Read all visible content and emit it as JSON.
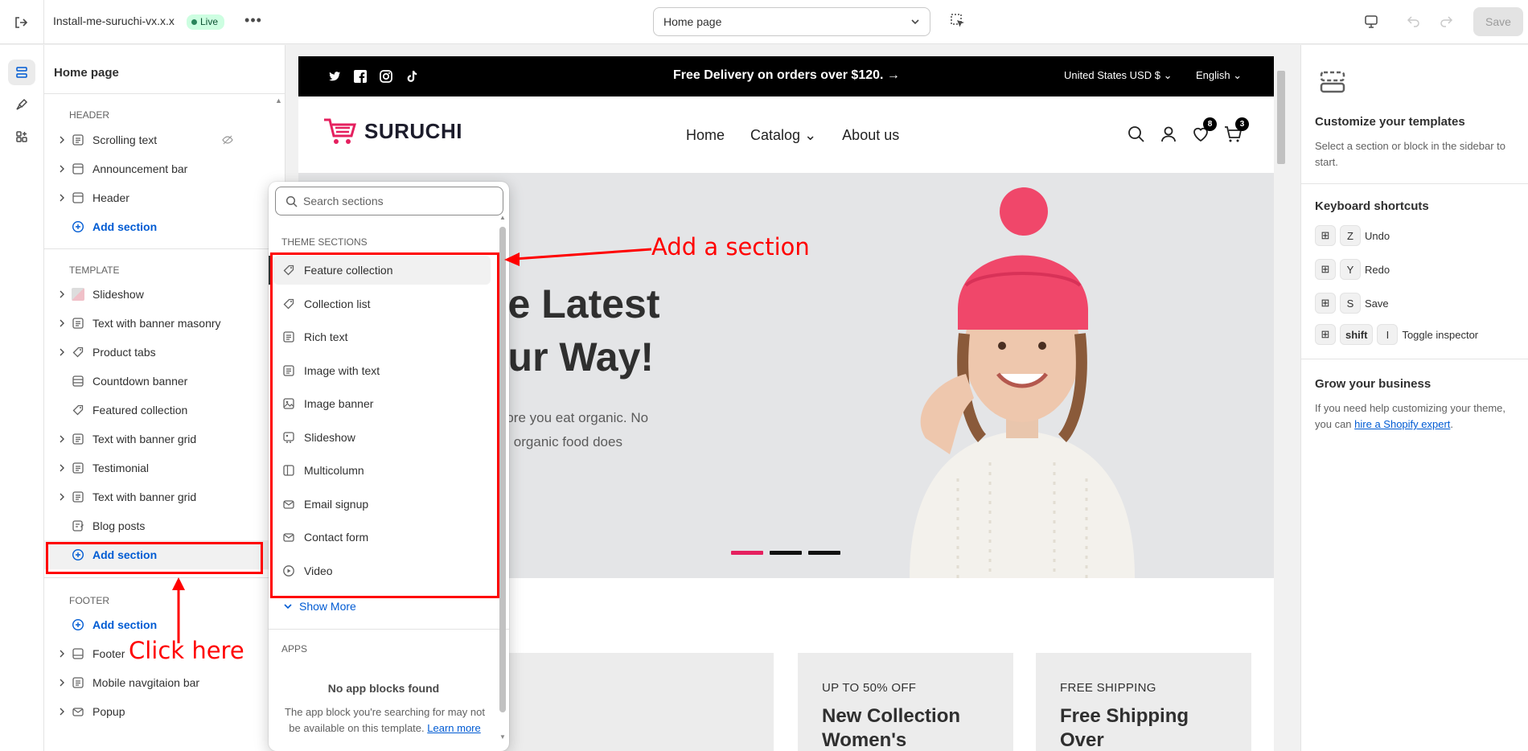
{
  "topbar": {
    "theme_name": "Install-me-suruchi-vx.x.x",
    "status_badge": "Live",
    "more_label": "•••",
    "page_select": "Home page",
    "save_label": "Save"
  },
  "sidebar": {
    "title": "Home page",
    "groups": {
      "header": "HEADER",
      "template": "TEMPLATE",
      "footer": "FOOTER"
    },
    "header_items": [
      "Scrolling text",
      "Announcement bar",
      "Header"
    ],
    "template_items": [
      "Slideshow",
      "Text with banner masonry",
      "Product tabs",
      "Countdown banner",
      "Featured collection",
      "Text with banner grid",
      "Testimonial",
      "Text with banner grid",
      "Blog posts"
    ],
    "footer_items": [
      "Footer",
      "Mobile navgitaion bar",
      "Popup"
    ],
    "add_section": "Add section"
  },
  "preview": {
    "announcement": "Free Delivery on orders over $120.",
    "currency": "United States USD $",
    "language": "English",
    "logo": "SURUCHI",
    "nav": [
      "Home",
      "Catalog",
      "About us"
    ],
    "wishlist_count": "8",
    "cart_count": "3",
    "hero_line1": "he Latest",
    "hero_line2": "our Way!",
    "hero_p1": "e more you eat organic. No",
    "hero_p2": "than organic food does",
    "cards": [
      {
        "kicker": "",
        "title": ""
      },
      {
        "kicker": "UP TO 50% OFF",
        "title": "New Collection",
        "title2": "Women's"
      },
      {
        "kicker": "FREE SHIPPING",
        "title": "Free Shipping",
        "title2": "Over"
      }
    ]
  },
  "popover": {
    "search_placeholder": "Search sections",
    "theme_group": "THEME SECTIONS",
    "items": [
      "Feature collection",
      "Collection list",
      "Rich text",
      "Image with text",
      "Image banner",
      "Slideshow",
      "Multicolumn",
      "Email signup",
      "Contact form",
      "Video"
    ],
    "show_more": "Show More",
    "apps_group": "APPS",
    "empty_title": "No app blocks found",
    "empty_text": "The app block you're searching for may not be available on this template.",
    "learn_more": "Learn more"
  },
  "right": {
    "customize_title": "Customize your templates",
    "customize_text": "Select a section or block in the sidebar to start.",
    "shortcuts_title": "Keyboard shortcuts",
    "shortcuts": [
      {
        "key": "Z",
        "label": "Undo"
      },
      {
        "key": "Y",
        "label": "Redo"
      },
      {
        "key": "S",
        "label": "Save"
      }
    ],
    "inspector": {
      "mod": "shift",
      "key": "I",
      "label": "Toggle inspector"
    },
    "grow_title": "Grow your business",
    "grow_text": "If you need help customizing your theme, you can",
    "grow_link": "hire a Shopify expert",
    "grow_end": "."
  },
  "annotations": {
    "add_a_section": "Add a section",
    "click_here": "Click here"
  },
  "colors": {
    "accent": "#005bd3",
    "annotation": "#ff0000",
    "brand_pink": "#e5205f"
  }
}
